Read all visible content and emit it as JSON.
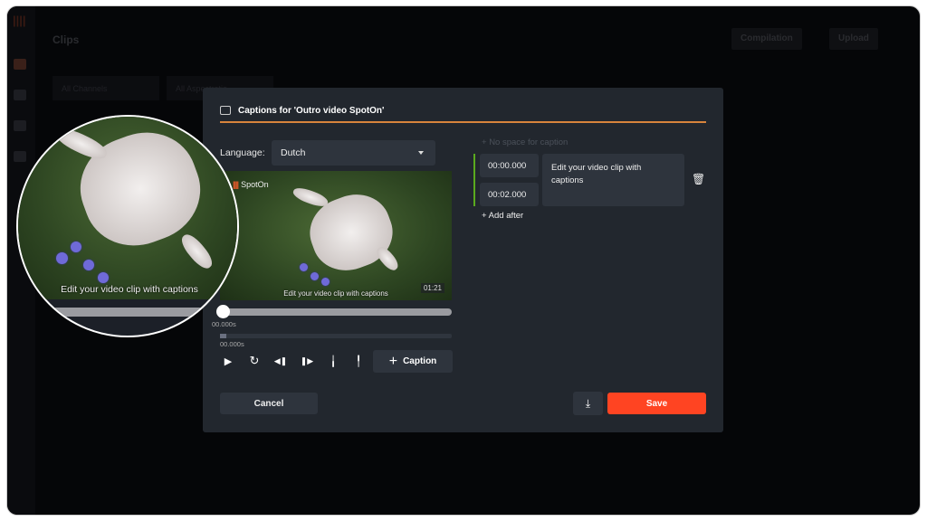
{
  "background": {
    "page_title": "Clips",
    "compilation_button": "Compilation",
    "upload_button": "Upload",
    "channel_filter": "All Channels",
    "aspect_filter": "All Aspectratio"
  },
  "modal": {
    "title": "Captions for 'Outro video SpotOn'",
    "language_label": "Language:",
    "language_value": "Dutch",
    "video": {
      "logo_text": "SpotOn",
      "caption_overlay": "Edit your video clip with captions",
      "duration": "01:21"
    },
    "seek_time": "00.000s",
    "timeline_time": "00.000s",
    "progress": 0,
    "controls": [
      "play-icon",
      "replay-icon",
      "step-back-icon",
      "step-forward-icon",
      "set-start-icon",
      "set-end-icon"
    ],
    "add_caption_label": "Caption",
    "no_space_label": "No space for caption",
    "captions": [
      {
        "start": "00:00.000",
        "end": "00:02.000",
        "text": "Edit your video clip with captions"
      }
    ],
    "add_after_label": "Add after",
    "cancel_label": "Cancel",
    "save_label": "Save"
  },
  "magnifier": {
    "caption_overlay": "Edit your video clip with captions"
  },
  "colors": {
    "accent": "#d8843c",
    "save": "#ff4422",
    "active_caption": "#5aaa1e",
    "modal_bg": "#22272e"
  }
}
